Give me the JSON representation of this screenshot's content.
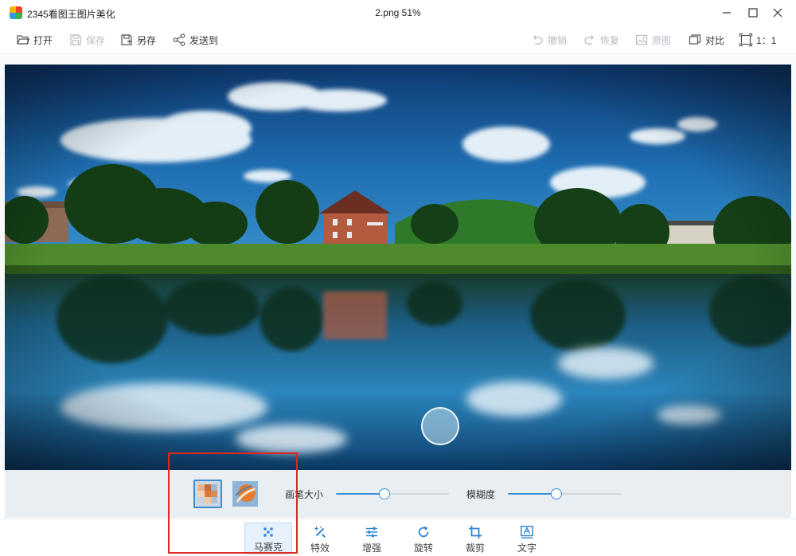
{
  "titlebar": {
    "app_title": "2345看图王图片美化",
    "file_info": "2.png   51%",
    "icons": [
      "app-logo",
      "minimize-icon",
      "maximize-icon",
      "close-icon"
    ]
  },
  "toolbar": {
    "left": [
      {
        "label": "打开",
        "icon": "folder-open-icon",
        "enabled": true
      },
      {
        "label": "保存",
        "icon": "save-icon",
        "enabled": false
      },
      {
        "label": "另存",
        "icon": "save-as-icon",
        "enabled": true
      },
      {
        "label": "发送到",
        "icon": "share-icon",
        "enabled": true
      }
    ],
    "right": [
      {
        "label": "撤销",
        "icon": "undo-icon",
        "enabled": false
      },
      {
        "label": "恢复",
        "icon": "redo-icon",
        "enabled": false
      },
      {
        "label": "原图",
        "icon": "original-image-icon",
        "enabled": false
      },
      {
        "label": "对比",
        "icon": "compare-icon",
        "enabled": true
      },
      {
        "label": "1：1",
        "icon": "actual-size-icon",
        "enabled": true
      }
    ]
  },
  "canvas": {
    "image_description": "lakeside landscape with house, trees and reflection"
  },
  "mosaic_panel": {
    "styles": [
      {
        "name": "mosaic-pixel",
        "selected": true
      },
      {
        "name": "mosaic-paint",
        "selected": false
      }
    ],
    "brush_size_label": "画笔大小",
    "brush_size_value": 0.43,
    "blur_label": "模糊度",
    "blur_value": 0.43
  },
  "bottom_tools": [
    {
      "label": "马赛克",
      "icon": "mosaic-icon",
      "active": true
    },
    {
      "label": "特效",
      "icon": "magic-wand-icon",
      "active": false
    },
    {
      "label": "增强",
      "icon": "adjust-sliders-icon",
      "active": false
    },
    {
      "label": "旋转",
      "icon": "rotate-icon",
      "active": false
    },
    {
      "label": "裁剪",
      "icon": "crop-icon",
      "active": false
    },
    {
      "label": "文字",
      "icon": "text-icon",
      "active": false
    }
  ],
  "colors": {
    "accent": "#3d8fd8",
    "highlight": "#e0261f",
    "disabled_text": "#b8bcc2",
    "icon_blue": "#2f86d3"
  }
}
